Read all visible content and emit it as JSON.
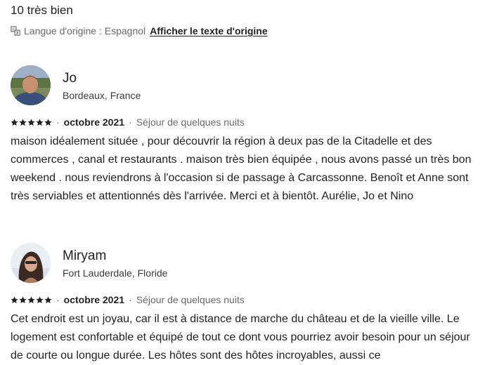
{
  "rating_text": "10 très bien",
  "language": {
    "label": "Langue d'origine : Espagnol",
    "link": "Afficher le texte d'origine"
  },
  "reviews": [
    {
      "name": "Jo",
      "location": "Bordeaux, France",
      "stars": 5,
      "date": "octobre 2021",
      "stay": "Séjour de quelques nuits",
      "text": "maison idéalement située , pour découvrir la région à deux pas de la Citadelle et des commerces , canal et restaurants . maison très bien équipée , nous avons passé un très bon weekend . nous reviendrons à l'occasion si de passage à Carcassonne. Benoît et Anne sont très serviables et attentionnés dès l'arrivée. Merci et à bientôt. Aurélie, Jo et Nino"
    },
    {
      "name": "Miryam",
      "location": "Fort Lauderdale, Floride",
      "stars": 5,
      "date": "octobre 2021",
      "stay": "Séjour de quelques nuits",
      "text": "Cet endroit est un joyau, car il est à distance de marche du château et de la vieille ville. Le logement est confortable et équipé de tout ce dont vous pourriez avoir besoin pour un séjour de courte ou longue durée. Les hôtes sont des hôtes incroyables, aussi ce"
    }
  ],
  "colors": {
    "text": "#222222",
    "muted": "#6a6a6a"
  }
}
